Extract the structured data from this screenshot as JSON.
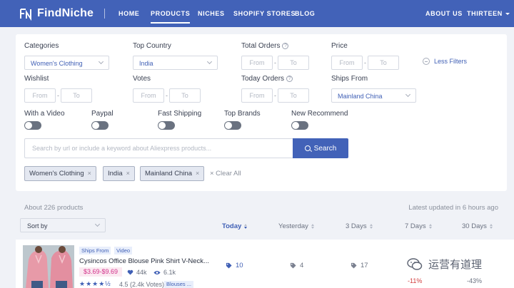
{
  "brand": {
    "name": "FindNiche"
  },
  "nav": {
    "items": [
      {
        "label": "HOME"
      },
      {
        "label": "PRODUCTS"
      },
      {
        "label": "NICHES"
      },
      {
        "label": "SHOPIFY STORES"
      },
      {
        "label": "BLOG"
      }
    ],
    "right": [
      {
        "label": "ABOUT US"
      },
      {
        "label": "THIRTEEN"
      }
    ]
  },
  "filters": {
    "categories": {
      "label": "Categories",
      "value": "Women's Clothing"
    },
    "top_country": {
      "label": "Top Country",
      "value": "India"
    },
    "total_orders": {
      "label": "Total Orders",
      "from": "From",
      "to": "To"
    },
    "price": {
      "label": "Price",
      "from": "From",
      "to": "To"
    },
    "less_filters": "Less Filters",
    "wishlist": {
      "label": "Wishlist",
      "from": "From",
      "to": "To"
    },
    "votes": {
      "label": "Votes",
      "from": "From",
      "to": "To"
    },
    "today_orders": {
      "label": "Today Orders",
      "from": "From",
      "to": "To"
    },
    "ships_from": {
      "label": "Ships From",
      "value": "Mainland China"
    },
    "dash": "-",
    "toggles": [
      {
        "label": "With a Video",
        "on": false
      },
      {
        "label": "Paypal",
        "on": false
      },
      {
        "label": "Fast Shipping",
        "on": false
      },
      {
        "label": "Top Brands",
        "on": false
      },
      {
        "label": "New Recommend",
        "on": false
      }
    ],
    "search_placeholder": "Search by url or include a keyword about Aliexpress products...",
    "search_button": "Search",
    "chips": [
      {
        "label": "Women's Clothing",
        "close": "×"
      },
      {
        "label": "India",
        "close": "×"
      },
      {
        "label": "Mainland China",
        "close": "×"
      }
    ],
    "clear_all": "× Clear All"
  },
  "results": {
    "count_text": "About 226 products",
    "updated_text": "Latest updated in 6 hours ago",
    "sort_by": "Sort by",
    "columns": [
      {
        "label": "Today"
      },
      {
        "label": "Yesterday"
      },
      {
        "label": "3 Days"
      },
      {
        "label": "7 Days"
      },
      {
        "label": "30 Days"
      }
    ]
  },
  "product": {
    "tags": [
      "Ships From",
      "Video"
    ],
    "title": "Cysincos Office Blouse Pink Shirt V-Neck...",
    "price": "$3.69-$9.69",
    "wishlist": "44k",
    "views": "6.1k",
    "stars": "★★★★½",
    "rating": "4.5 (2.4k Votes)",
    "category": "Blouses ...",
    "today": "10",
    "yesterday": "4",
    "three_days": "17",
    "seven_days": "-11%",
    "thirty_days": "-43%"
  },
  "watermark": "运营有道理",
  "colors": {
    "primary": "#4262b8",
    "accent_text": "#3f5fb5",
    "price": "#d2318a",
    "negative": "#d24040"
  }
}
